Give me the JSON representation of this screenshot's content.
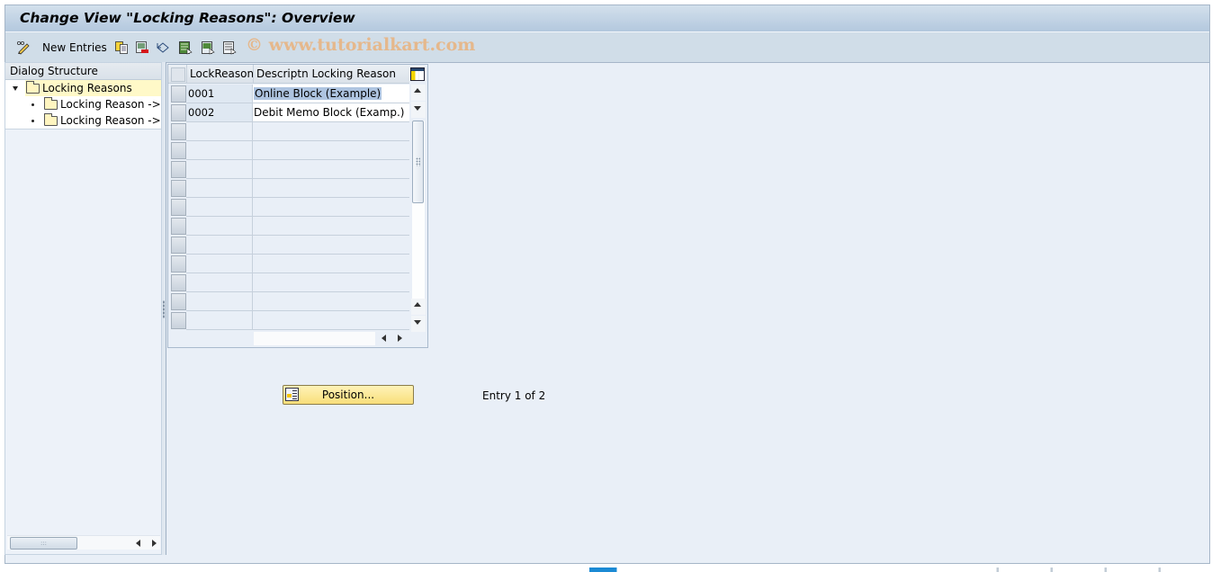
{
  "window": {
    "title": "Change View \"Locking Reasons\": Overview"
  },
  "toolbar": {
    "items": [
      {
        "icon": "change-display-icon"
      },
      {
        "label": "New Entries",
        "icon": "new-entries"
      },
      {
        "icon": "copy-icon"
      },
      {
        "icon": "delete-icon"
      },
      {
        "icon": "undo-change-icon"
      },
      {
        "icon": "select-all-icon"
      },
      {
        "icon": "select-block-icon"
      },
      {
        "icon": "deselect-all-icon"
      }
    ],
    "new_entries_label": "New Entries",
    "watermark": "© www.tutorialkart.com"
  },
  "dialog_structure": {
    "header": "Dialog Structure",
    "items": [
      {
        "label": "Locking Reasons",
        "level": 0,
        "expanded": true,
        "selected": true
      },
      {
        "label": "Locking Reason -> M",
        "level": 1
      },
      {
        "label": "Locking Reason -> Fu",
        "level": 1
      }
    ]
  },
  "table": {
    "columns": [
      "LockReason",
      "Descriptn Locking Reason"
    ],
    "rows": [
      {
        "key": "0001",
        "description": "Online Block (Example)",
        "selected": true
      },
      {
        "key": "0002",
        "description": "Debit Memo Block (Examp.)"
      }
    ],
    "visible_rows": 13
  },
  "position_button": {
    "label": "Position..."
  },
  "entry_info": "Entry 1 of 2",
  "colors": {
    "background": "#e9eff7",
    "title_bar": "#b3c8de",
    "button_yellow": "#f8de7a",
    "selection_highlight": "#aec4e0",
    "tree_selected": "#fff9c8",
    "watermark": "#e8b483"
  }
}
